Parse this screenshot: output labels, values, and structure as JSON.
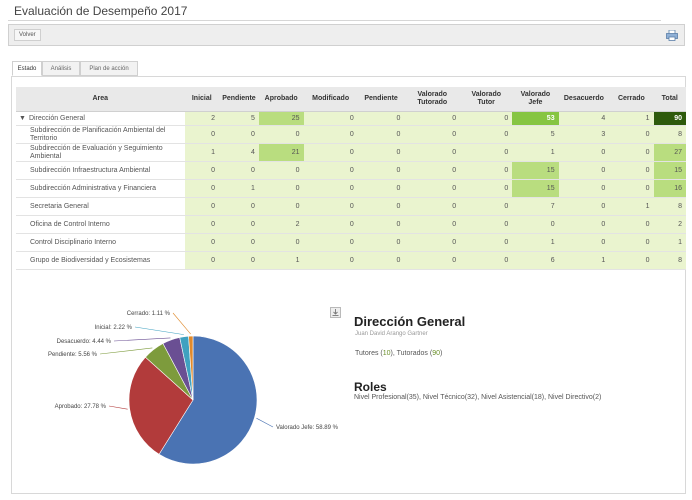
{
  "page": {
    "title": "Evaluación de Desempeño 2017"
  },
  "toolbar": {
    "back_label": "Volver",
    "print_icon": "printer-icon"
  },
  "tabs": [
    {
      "label": "Estado"
    },
    {
      "label": "Análisis"
    },
    {
      "label": "Plan de acción"
    }
  ],
  "table": {
    "headers": [
      "Area",
      "Inicial",
      "Pendiente",
      "Aprobado",
      "Modificado",
      "Pendiente",
      "Valorado Tutorado",
      "Valorado Tutor",
      "Valorado Jefe",
      "Desacuerdo",
      "Cerrado",
      "Total"
    ],
    "rows": [
      {
        "area": "Dirección General",
        "expand": "▼",
        "v": [
          "2",
          "5",
          "25",
          "0",
          "0",
          "0",
          "0",
          "53",
          "4",
          "1",
          "90"
        ]
      },
      {
        "area": "Subdirección de Planificación Ambiental del Territorio",
        "v": [
          "0",
          "0",
          "0",
          "0",
          "0",
          "0",
          "0",
          "5",
          "3",
          "0",
          "8"
        ]
      },
      {
        "area": "Subdirección de Evaluación y Seguimiento Ambiental",
        "v": [
          "1",
          "4",
          "21",
          "0",
          "0",
          "0",
          "0",
          "1",
          "0",
          "0",
          "27"
        ]
      },
      {
        "area": "Subdirección Infraestructura Ambiental",
        "v": [
          "0",
          "0",
          "0",
          "0",
          "0",
          "0",
          "0",
          "15",
          "0",
          "0",
          "15"
        ]
      },
      {
        "area": "Subdirección Administrativa y Financiera",
        "v": [
          "0",
          "1",
          "0",
          "0",
          "0",
          "0",
          "0",
          "15",
          "0",
          "0",
          "16"
        ]
      },
      {
        "area": "Secretaria General",
        "v": [
          "0",
          "0",
          "0",
          "0",
          "0",
          "0",
          "0",
          "7",
          "0",
          "1",
          "8"
        ]
      },
      {
        "area": "Oficina de Control Interno",
        "v": [
          "0",
          "0",
          "2",
          "0",
          "0",
          "0",
          "0",
          "0",
          "0",
          "0",
          "2"
        ]
      },
      {
        "area": "Control Disciplinario Interno",
        "v": [
          "0",
          "0",
          "0",
          "0",
          "0",
          "0",
          "0",
          "1",
          "0",
          "0",
          "1"
        ]
      },
      {
        "area": "Grupo de Biodiversidad y Ecosistemas",
        "v": [
          "0",
          "0",
          "1",
          "0",
          "0",
          "0",
          "0",
          "6",
          "1",
          "0",
          "8"
        ]
      }
    ]
  },
  "colors": {
    "top_total": "#2e5a0c",
    "strong": "#86c542",
    "medium": "#b9dd7f",
    "pale": "#eaf4cf",
    "white": "#ffffff"
  },
  "chart_data": {
    "type": "pie",
    "slices": [
      {
        "name": "Valorado Jefe",
        "value": 58.89,
        "label": "Valorado Jefe: 58.89 %",
        "color": "#4a73b3"
      },
      {
        "name": "Aprobado",
        "value": 27.78,
        "label": "Aprobado: 27.78 %",
        "color": "#b23b3b"
      },
      {
        "name": "Pendiente",
        "value": 5.56,
        "label": "Pendiente: 5.56 %",
        "color": "#7d9b3c"
      },
      {
        "name": "Desacuerdo",
        "value": 4.44,
        "label": "Desacuerdo: 4.44 %",
        "color": "#6a4f93"
      },
      {
        "name": "Inicial",
        "value": 2.22,
        "label": "Inicial: 2.22 %",
        "color": "#3fa1c0"
      },
      {
        "name": "Cerrado",
        "value": 1.11,
        "label": "Cerrado: 1.11 %",
        "color": "#e08a2c"
      }
    ]
  },
  "detail": {
    "title": "Dirección General",
    "subtitle": "Juan David Arango Gartner",
    "tutores_label": "Tutores (",
    "tutores_count": "10",
    "tutorados_label": "), Tutorados (",
    "tutorados_count": "90",
    "tut_close": ")",
    "roles_title": "Roles",
    "roles_list": "Nivel Profesional(35), Nivel Técnico(32), Nivel Asistencial(18), Nivel Directivo(2)"
  }
}
